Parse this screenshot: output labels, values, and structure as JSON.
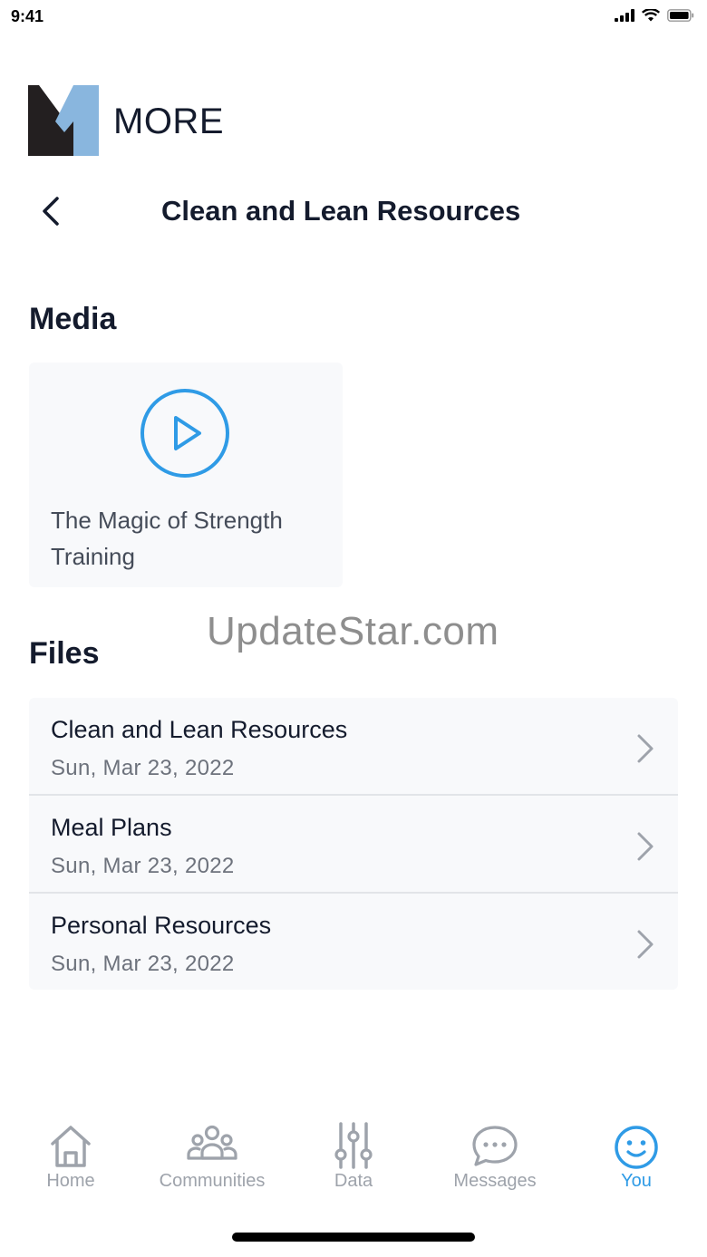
{
  "status_bar": {
    "time": "9:41"
  },
  "logo": {
    "text": "MORE"
  },
  "header": {
    "title": "Clean and Lean Resources"
  },
  "media": {
    "section_title": "Media",
    "items": [
      {
        "title": "The Magic of Strength Training"
      }
    ]
  },
  "watermark": "UpdateStar.com",
  "files": {
    "section_title": "Files",
    "items": [
      {
        "name": "Clean and Lean Resources",
        "date": "Sun, Mar 23, 2022"
      },
      {
        "name": "Meal Plans",
        "date": "Sun, Mar 23, 2022"
      },
      {
        "name": "Personal Resources",
        "date": "Sun, Mar 23, 2022"
      }
    ]
  },
  "tab_bar": {
    "tabs": [
      {
        "label": "Home",
        "icon": "home-icon"
      },
      {
        "label": "Communities",
        "icon": "communities-icon"
      },
      {
        "label": "Data",
        "icon": "sliders-icon"
      },
      {
        "label": "Messages",
        "icon": "message-bubble-icon"
      },
      {
        "label": "You",
        "icon": "smiley-icon"
      }
    ],
    "active": "You"
  },
  "colors": {
    "accent": "#2f9be6",
    "text_primary": "#141b2d",
    "text_secondary": "#6d727c",
    "card_bg": "#f8f9fb",
    "tab_inactive": "#9ea3ab",
    "logo_dark": "#231f20",
    "logo_light": "#89b6de"
  }
}
